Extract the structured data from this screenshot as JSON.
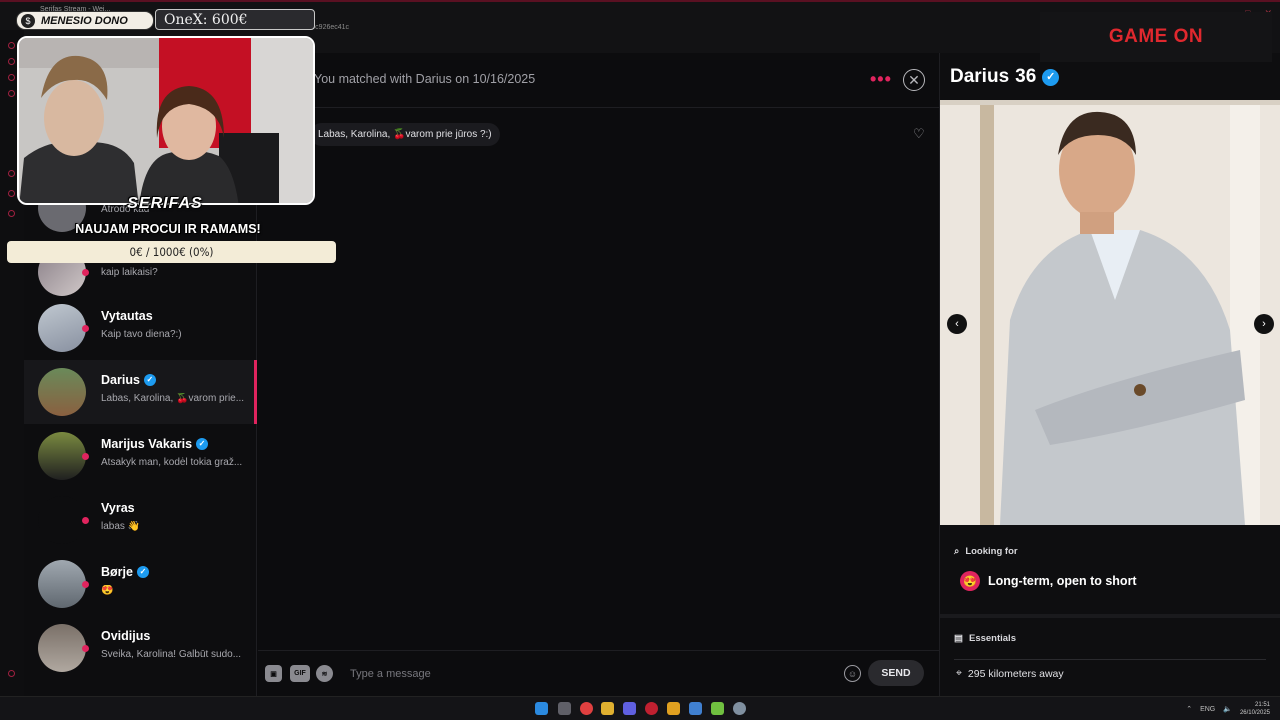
{
  "browser": {
    "tab_title": "Serifas Stream - Wei...",
    "address_fragment": "7ca5c926ec41c"
  },
  "overlay": {
    "donor_label": "MENESIO DONO",
    "onex_label": "OneX: 600€",
    "streamer": "SERIFAS",
    "tagline": "NAUJAM PROCUI IR RAMAMS!",
    "goal": "0€ / 1000€ (0%)",
    "sponsor": "GAME ON"
  },
  "chat_list": {
    "items": [
      {
        "name": "",
        "preview": "Atrodo kad",
        "verified": false
      },
      {
        "name": "",
        "preview": "kaip laikaisi?",
        "verified": false
      },
      {
        "name": "Vytautas",
        "preview": "Kaip tavo diena?:)",
        "verified": false
      },
      {
        "name": "Darius",
        "preview": "Labas, Karolina, 🍒varom prie...",
        "verified": true
      },
      {
        "name": "Marijus Vakaris",
        "preview": "Atsakyk man, kodėl tokia graž...",
        "verified": true
      },
      {
        "name": "Vyras",
        "preview": "labas 👋",
        "verified": false
      },
      {
        "name": "Børje",
        "preview": "😍",
        "verified": true
      },
      {
        "name": "Ovidijus",
        "preview": "Sveika, Karolina! Galbūt sudo...",
        "verified": false
      }
    ]
  },
  "chat": {
    "match_text": "You matched with Darius on 10/16/2025",
    "message": "Labas, Karolina, 🍒varom prie jūros ?:)",
    "input_placeholder": "Type a message",
    "gif_label": "GIF",
    "send_label": "SEND"
  },
  "profile": {
    "name": "Darius",
    "age": "36",
    "looking_for_title": "Looking for",
    "looking_for_value": "Long-term, open to short",
    "essentials_title": "Essentials",
    "distance": "295 kilometers away"
  },
  "taskbar": {
    "lang": "ENG",
    "time": "21:51",
    "date": "26/10/2025"
  },
  "colors": {
    "accent": "#e0245e",
    "verified": "#1d9bf0",
    "background": "#0c0c0e"
  }
}
